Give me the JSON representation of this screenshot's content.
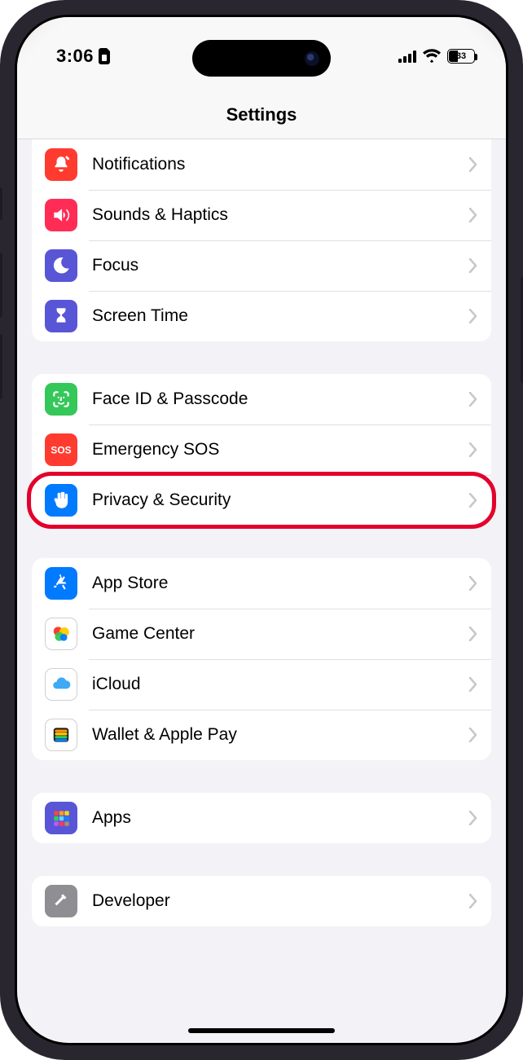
{
  "status": {
    "time": "3:06",
    "battery_pct": "33"
  },
  "nav": {
    "title": "Settings"
  },
  "groups": [
    {
      "rows": [
        {
          "label": "Notifications",
          "icon": "bell-icon",
          "bg": "bg-red"
        },
        {
          "label": "Sounds & Haptics",
          "icon": "speaker-icon",
          "bg": "bg-pink"
        },
        {
          "label": "Focus",
          "icon": "moon-icon",
          "bg": "bg-indigo"
        },
        {
          "label": "Screen Time",
          "icon": "hourglass-icon",
          "bg": "bg-indigo"
        }
      ]
    },
    {
      "rows": [
        {
          "label": "Face ID & Passcode",
          "icon": "faceid-icon",
          "bg": "bg-green"
        },
        {
          "label": "Emergency SOS",
          "icon": "sos-icon",
          "bg": "bg-red"
        },
        {
          "label": "Privacy & Security",
          "icon": "hand-icon",
          "bg": "bg-blue",
          "highlight": true
        }
      ]
    },
    {
      "rows": [
        {
          "label": "App Store",
          "icon": "appstore-icon",
          "bg": "bg-blue"
        },
        {
          "label": "Game Center",
          "icon": "gamecenter-icon",
          "bg": "bg-white"
        },
        {
          "label": "iCloud",
          "icon": "icloud-icon",
          "bg": "bg-white"
        },
        {
          "label": "Wallet & Apple Pay",
          "icon": "wallet-icon",
          "bg": "bg-white"
        }
      ]
    },
    {
      "rows": [
        {
          "label": "Apps",
          "icon": "apps-grid-icon",
          "bg": "bg-purple"
        }
      ]
    },
    {
      "rows": [
        {
          "label": "Developer",
          "icon": "hammer-icon",
          "bg": "bg-grey"
        }
      ]
    }
  ]
}
